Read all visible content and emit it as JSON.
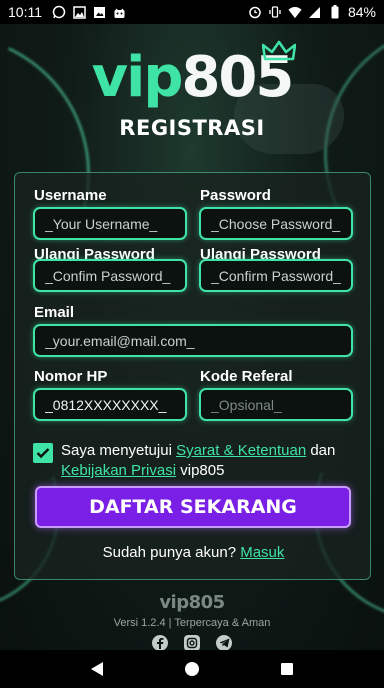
{
  "status_bar": {
    "time": "10:11",
    "battery": "84%",
    "left_icons": [
      "whatsapp-icon",
      "image-icon",
      "image-icon",
      "android-icon"
    ],
    "right_icons": [
      "alarm-icon",
      "vibrate-icon",
      "wifi-icon",
      "signal-icon",
      "battery-icon"
    ]
  },
  "header": {
    "logo_vip": "vip",
    "logo_num": "805",
    "title": "REGISTRASI"
  },
  "form": {
    "username": {
      "label": "Username",
      "placeholder": "_Your Username_"
    },
    "password": {
      "label": "Password",
      "placeholder": "_Choose Password_"
    },
    "confirm_password_left": {
      "label": "Ulangi Password",
      "placeholder": "_Confim Password_"
    },
    "confirm_password_right": {
      "label": "Ulangi Password",
      "placeholder": "_Confirm Password_"
    },
    "email": {
      "label": "Email",
      "placeholder": "_your.email@mail.com_"
    },
    "phone": {
      "label": "Nomor HP",
      "value": "_0812XXXXXXXX_"
    },
    "referral": {
      "label": "Kode Referal",
      "placeholder": "_Opsional_"
    },
    "agree": {
      "checked": true,
      "text_before": "Saya menyetujui ",
      "terms_link": "Syarat & Ketentuan",
      "text_middle": " dan ",
      "privacy_link": "Kebijakan Privasi",
      "text_after": " vip805"
    },
    "submit_label": "DAFTAR SEKARANG",
    "login_prompt": "Sudah punya akun? ",
    "login_link": "Masuk"
  },
  "footer": {
    "logo": "vip805",
    "version": "Versi 1.2.4 | Terpercaya & Aman",
    "social_icons": [
      "facebook-icon",
      "instagram-icon",
      "telegram-icon"
    ]
  },
  "colors": {
    "accent": "#3fe3a6",
    "button": "#7a1fe6",
    "button_border": "#c99bff",
    "background": "#0c1512"
  }
}
